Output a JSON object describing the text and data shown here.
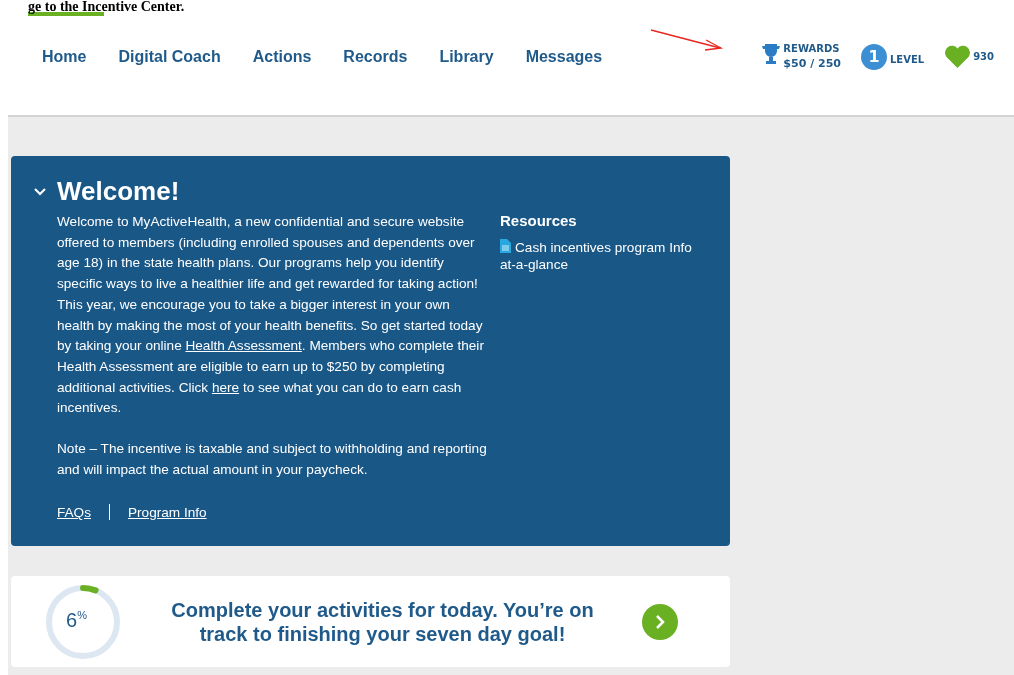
{
  "annotation": {
    "caption": "ge to the Incentive Center."
  },
  "nav": {
    "items": [
      {
        "label": "Home"
      },
      {
        "label": "Digital Coach"
      },
      {
        "label": "Actions"
      },
      {
        "label": "Records"
      },
      {
        "label": "Library"
      },
      {
        "label": "Messages"
      }
    ]
  },
  "status": {
    "rewards_label": "REWARDS",
    "rewards_value": "$50 / 250",
    "level_number": "1",
    "level_label": "LEVEL",
    "points": "930"
  },
  "welcome": {
    "title": "Welcome!",
    "expanded": true,
    "body": "Welcome to MyActiveHealth, a new confidential and secure website offered to members (including enrolled spouses and dependents over age 18) in the state health plans. Our programs help you identify specific ways to live a healthier life and get rewarded for taking action! This year, we encourage you to take a bigger interest in your own health by making the most of your health benefits. So get started today by taking your online ",
    "link_1": "Health Assessment",
    "body_2": ". Members who complete their Health Assessment are eligible to earn up to $250 by completing additional activities. Click ",
    "link_2": "here",
    "body_3": " to see what you can do to earn cash incentives.",
    "note": "Note – The incentive is taxable and subject to withholding and reporting and will impact the actual amount in your paycheck.",
    "links": [
      "FAQs",
      "Program Info"
    ],
    "resources_title": "Resources",
    "resources": [
      "Cash incentives program Info at-a-glance"
    ]
  },
  "progress": {
    "level": 0.06,
    "value": "6",
    "unit": "%",
    "message": "Complete your activities for today. You’re on track to finishing your seven day goal!"
  }
}
